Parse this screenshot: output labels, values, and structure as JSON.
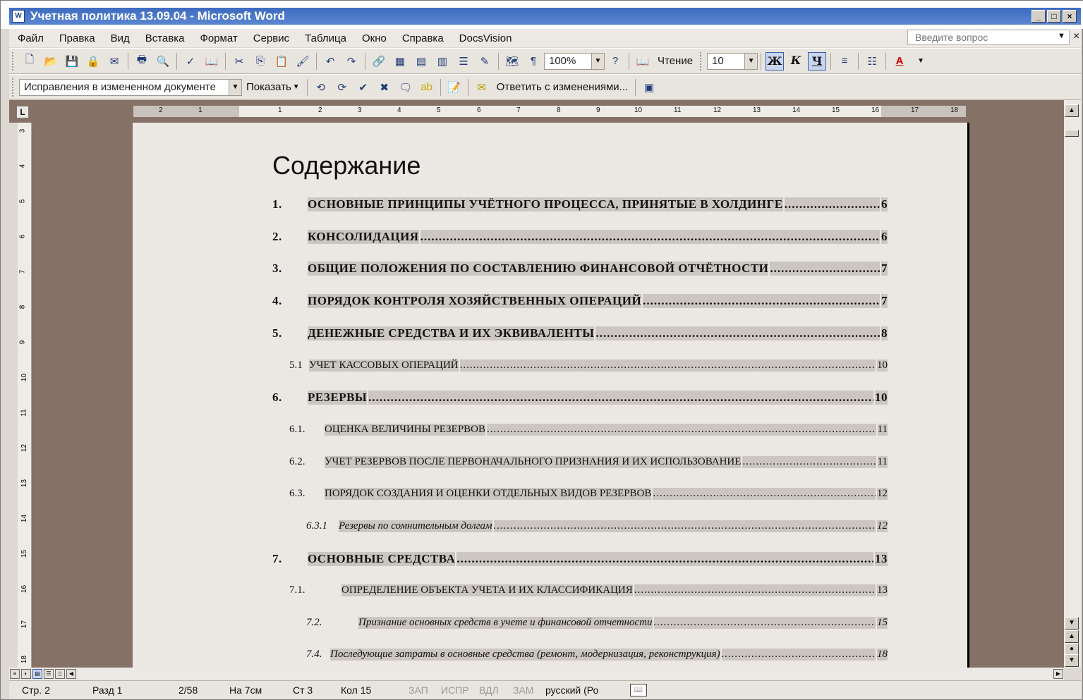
{
  "window": {
    "title": "Учетная политика 13.09.04 - Microsoft Word",
    "minimize": "_",
    "maximize": "□",
    "close": "×"
  },
  "menubar": {
    "items": [
      "Файл",
      "Правка",
      "Вид",
      "Вставка",
      "Формат",
      "Сервис",
      "Таблица",
      "Окно",
      "Справка",
      "DocsVision"
    ],
    "ask_placeholder": "Введите вопрос",
    "close": "×"
  },
  "toolbar1": {
    "zoom": "100%",
    "reading": "Чтение",
    "font_size": "10",
    "bold": "Ж",
    "italic": "К",
    "underline": "Ч",
    "font_color_glyph": "A"
  },
  "toolbar2": {
    "review_mode": "Исправления в измененном документе",
    "show": "Показать",
    "reply_with_changes": "Ответить с изменениями..."
  },
  "ruler": {
    "corner": "L",
    "ticks": [
      "2",
      "1",
      "1",
      "2",
      "3",
      "4",
      "5",
      "6",
      "7",
      "8",
      "9",
      "10",
      "11",
      "12",
      "13",
      "14",
      "15",
      "16",
      "17",
      "18"
    ],
    "vticks": [
      "3",
      "4",
      "5",
      "6",
      "7",
      "8",
      "9",
      "10",
      "11",
      "12",
      "13",
      "14",
      "15",
      "16",
      "17",
      "18"
    ]
  },
  "document": {
    "heading": "Содержание",
    "toc": [
      {
        "num": "1.",
        "text": "ОСНОВНЫЕ ПРИНЦИПЫ УЧЁТНОГО ПРОЦЕССА, ПРИНЯТЫЕ В ХОЛДИНГЕ",
        "page": "6",
        "level": 1
      },
      {
        "num": "2.",
        "text": "КОНСОЛИДАЦИЯ",
        "page": "6",
        "level": 1
      },
      {
        "num": "3.",
        "text": "ОБЩИЕ ПОЛОЖЕНИЯ ПО СОСТАВЛЕНИЮ ФИНАНСОВОЙ ОТЧЁТНОСТИ",
        "page": "7",
        "level": 1
      },
      {
        "num": "4.",
        "text": "ПОРЯДОК КОНТРОЛЯ ХОЗЯЙСТВЕННЫХ ОПЕРАЦИЙ",
        "page": "7",
        "level": 1
      },
      {
        "num": "5.",
        "text": "ДЕНЕЖНЫЕ СРЕДСТВА И ИХ ЭКВИВАЛЕНТЫ",
        "page": "8",
        "level": 1
      },
      {
        "num": "5.1",
        "text": "УЧЕТ КАССОВЫХ ОПЕРАЦИЙ",
        "page": "10",
        "level": 2
      },
      {
        "num": "6.",
        "text": "РЕЗЕРВЫ",
        "page": "10",
        "level": 1
      },
      {
        "num": "6.1.",
        "text": "ОЦЕНКА ВЕЛИЧИНЫ РЕЗЕРВОВ",
        "page": "11",
        "level": 2
      },
      {
        "num": "6.2.",
        "text": "УЧЕТ РЕЗЕРВОВ ПОСЛЕ ПЕРВОНАЧАЛЬНОГО ПРИЗНАНИЯ И ИХ ИСПОЛЬЗОВАНИЕ",
        "page": "11",
        "level": 2
      },
      {
        "num": "6.3.",
        "text": "ПОРЯДОК СОЗДАНИЯ И ОЦЕНКИ ОТДЕЛЬНЫХ ВИДОВ РЕЗЕРВОВ",
        "page": "12",
        "level": 2
      },
      {
        "num": "6.3.1",
        "text": "Резервы по сомнительным долгам",
        "page": "12",
        "level": 3
      },
      {
        "num": "7.",
        "text": "ОСНОВНЫЕ СРЕДСТВА",
        "page": "13",
        "level": 1
      },
      {
        "num": "7.1.",
        "text": "ОПРЕДЕЛЕНИЕ ОБЪЕКТА УЧЕТА И ИХ КЛАССИФИКАЦИЯ",
        "page": "13",
        "level": 2
      },
      {
        "num": "7.2.",
        "text": "Признание основных средств в учете и финансовой отчетности",
        "page": "15",
        "level": 3
      },
      {
        "num": "7.4.",
        "text": "Последующие затраты в основные средства (ремонт, модернизация, реконструкция)",
        "page": "18",
        "level": 3
      }
    ]
  },
  "statusbar": {
    "page": "Стр. 2",
    "section": "Разд 1",
    "pages": "2/58",
    "at": "На 7см",
    "line": "Ст 3",
    "col": "Кол 15",
    "rec": "ЗАП",
    "trk": "ИСПР",
    "ext": "ВДЛ",
    "ovr": "ЗАМ",
    "language": "русский (Ро"
  }
}
